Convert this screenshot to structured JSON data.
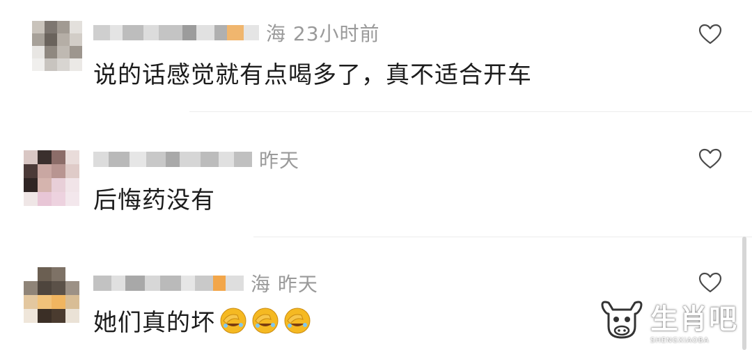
{
  "comments": [
    {
      "location_time": "海 23小时前",
      "text": "说的话感觉就有点喝多了，真不适合开车",
      "liked": false
    },
    {
      "location_time": "昨天",
      "text": "后悔药没有",
      "liked": false
    },
    {
      "location_time": "海 昨天",
      "text": "她们真的坏",
      "emojis": [
        "facepalm-laugh-emoji",
        "facepalm-laugh-emoji",
        "facepalm-laugh-emoji"
      ],
      "liked": false
    }
  ],
  "icons": {
    "like": "heart-outline-icon",
    "reaction": "facepalm-laugh-emoji"
  },
  "watermark": {
    "name": "生肖吧",
    "sub": "SHENGXIAOBA"
  },
  "colors": {
    "meta": "#9a9a9a",
    "text": "#1c1c1c",
    "divider": "#ececec",
    "emoji": "#f5b922"
  }
}
